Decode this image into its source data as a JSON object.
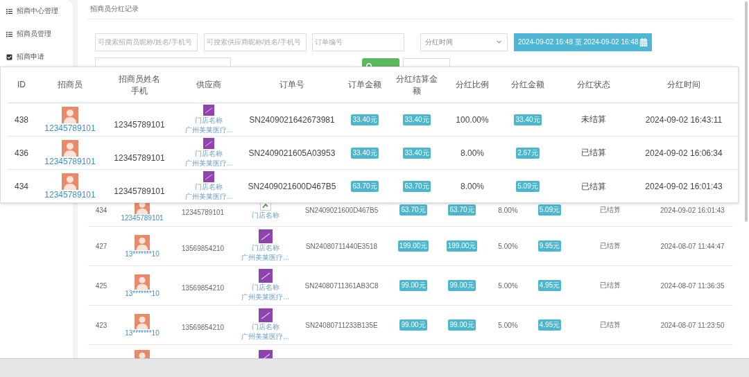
{
  "sidebar": {
    "items": [
      {
        "kind": "list",
        "label": "招商中心管理"
      },
      {
        "kind": "list",
        "label": "招商员管理"
      },
      {
        "kind": "check",
        "label": "招商申请"
      }
    ]
  },
  "page_title": "招商员分红记录",
  "filters": {
    "recruiter_search": {
      "placeholder": "可搜索招商员昵称/姓名/手机号"
    },
    "supplier_search": {
      "placeholder": "可搜索供应商昵称/姓名/手机号"
    },
    "order_search": {
      "placeholder": "订单编号"
    },
    "time_select": {
      "value": "分红时间"
    },
    "date_range": "2024-09-02 16:48 至 2024-09-02 16:48"
  },
  "popup_table": {
    "columns": [
      "ID",
      "招商员",
      "招商员姓名手机",
      "供应商",
      "订单号",
      "订单金额",
      "分红结算金额",
      "分红比例",
      "分红金额",
      "分红状态",
      "分红时间"
    ],
    "rows": [
      {
        "id": "438",
        "recruiter": "12345789101",
        "phone": "12345789101",
        "supplier": {
          "kind": "logo",
          "name": "门店名称",
          "company": "广州美莱医疗..."
        },
        "order": "SN2409021642673981",
        "amount": "33.40元",
        "settle_amount": "33.40元",
        "ratio": "100.00%",
        "dividend": "33.40元",
        "status": "未结算",
        "time": "2024-09-02 16:43:11"
      },
      {
        "id": "436",
        "recruiter": "12345789101",
        "phone": "12345789101",
        "supplier": {
          "kind": "logo",
          "name": "门店名称",
          "company": "广州美莱医疗..."
        },
        "order": "SN2409021605A03953",
        "amount": "33.40元",
        "settle_amount": "33.40元",
        "ratio": "8.00%",
        "dividend": "2.67元",
        "status": "已结算",
        "time": "2024-09-02 16:06:34"
      },
      {
        "id": "434",
        "recruiter": "12345789101",
        "phone": "12345789101",
        "supplier": {
          "kind": "logo",
          "name": "门店名称",
          "company": "广州美莱医疗..."
        },
        "order": "SN2409021600D467B5",
        "amount": "63.70元",
        "settle_amount": "63.70元",
        "ratio": "8.00%",
        "dividend": "5.09元",
        "status": "已结算",
        "time": "2024-09-02 16:01:43"
      }
    ]
  },
  "table": {
    "rows": [
      {
        "id": "434",
        "recruiter": "12345789101",
        "phone": "12345789101",
        "supplier": {
          "kind": "broken",
          "name": "门店名称"
        },
        "order": "SN2409021600D467B5",
        "amount": "63.70元",
        "settle_amount": "63.70元",
        "ratio": "8.00%",
        "dividend": "5.09元",
        "status": "已结算",
        "time": "2024-09-02 16:01:43"
      },
      {
        "id": "427",
        "recruiter": "13*******10",
        "phone": "13569854210",
        "supplier": {
          "kind": "logo",
          "name": "门店名称",
          "company": "广州美莱医疗..."
        },
        "order": "SN24080711440E3518",
        "amount": "199.00元",
        "settle_amount": "199.00元",
        "ratio": "5.00%",
        "dividend": "9.95元",
        "status": "已结算",
        "time": "2024-08-07 11:44:47"
      },
      {
        "id": "425",
        "recruiter": "13*******10",
        "phone": "13569854210",
        "supplier": {
          "kind": "logo",
          "name": "门店名称",
          "company": "广州美莱医疗..."
        },
        "order": "SN24080711361AB3C8",
        "amount": "99.00元",
        "settle_amount": "99.00元",
        "ratio": "5.00%",
        "dividend": "4.95元",
        "status": "已结算",
        "time": "2024-08-07 11:36:35"
      },
      {
        "id": "423",
        "recruiter": "13*******10",
        "phone": "13569854210",
        "supplier": {
          "kind": "logo",
          "name": "门店名称",
          "company": "广州美莱医疗..."
        },
        "order": "SN24080711233B135E",
        "amount": "99.00元",
        "settle_amount": "99.00元",
        "ratio": "5.00%",
        "dividend": "4.95元",
        "status": "已结算",
        "time": "2024-08-07 11:23:50"
      }
    ]
  }
}
